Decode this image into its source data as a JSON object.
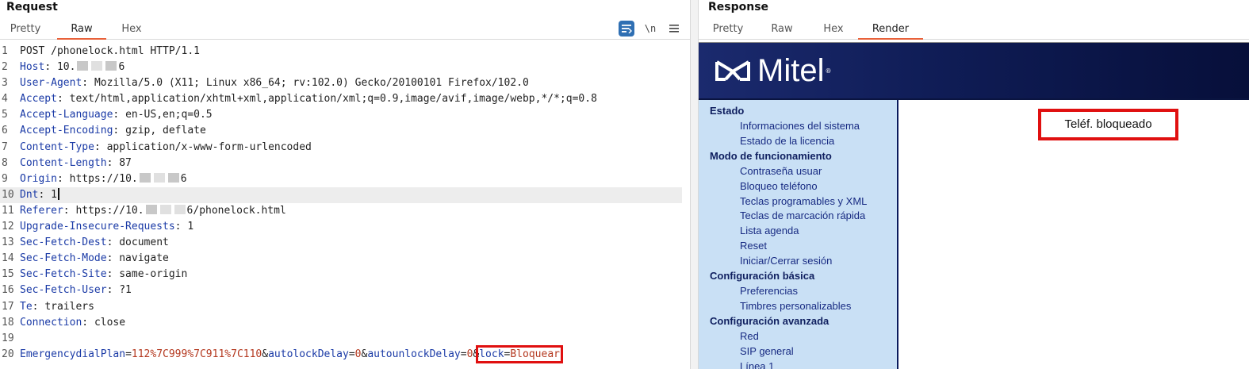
{
  "request": {
    "title": "Request",
    "tabs": [
      {
        "label": "Pretty"
      },
      {
        "label": "Raw"
      },
      {
        "label": "Hex"
      }
    ],
    "active_tab": "Raw",
    "tools": {
      "wrap_icon": "message-edit-icon",
      "newline_label": "\\n",
      "menu_icon": "hamburger-icon"
    },
    "lines": {
      "l1": "POST /phonelock.html HTTP/1.1",
      "l2_key": "Host",
      "l2_pre": "10.",
      "l2_post": "6",
      "l3_key": "User-Agent",
      "l3_val": "Mozilla/5.0 (X11; Linux x86_64; rv:102.0) Gecko/20100101 Firefox/102.0",
      "l4_key": "Accept",
      "l4_val": "text/html,application/xhtml+xml,application/xml;q=0.9,image/avif,image/webp,*/*;q=0.8",
      "l5_key": "Accept-Language",
      "l5_val": "en-US,en;q=0.5",
      "l6_key": "Accept-Encoding",
      "l6_val": "gzip, deflate",
      "l7_key": "Content-Type",
      "l7_val": "application/x-www-form-urlencoded",
      "l8_key": "Content-Length",
      "l8_val": "87",
      "l9_key": "Origin",
      "l9_pre": "https://10.",
      "l9_post": "6",
      "l10_key": "Dnt",
      "l10_val": "1",
      "l11_key": "Referer",
      "l11_pre": "https://10.",
      "l11_post": "6/phonelock.html",
      "l12_key": "Upgrade-Insecure-Requests",
      "l12_val": "1",
      "l13_key": "Sec-Fetch-Dest",
      "l13_val": "document",
      "l14_key": "Sec-Fetch-Mode",
      "l14_val": "navigate",
      "l15_key": "Sec-Fetch-Site",
      "l15_val": "same-origin",
      "l16_key": "Sec-Fetch-User",
      "l16_val": "?1",
      "l17_key": "Te",
      "l17_val": "trailers",
      "l18_key": "Connection",
      "l18_val": "close",
      "body": {
        "p1_key": "EmergencydialPlan",
        "p1_val": "112%7C999%7C911%7C110",
        "p2_key": "autolockDelay",
        "p2_val": "0",
        "p3_key": "autounlockDelay",
        "p3_val": "0",
        "p4_key": "lock",
        "p4_val": "Bloquear"
      }
    }
  },
  "response": {
    "title": "Response",
    "tabs": [
      {
        "label": "Pretty"
      },
      {
        "label": "Raw"
      },
      {
        "label": "Hex"
      },
      {
        "label": "Render"
      }
    ],
    "active_tab": "Render",
    "render": {
      "brand": "Mitel",
      "brand_mark": "®",
      "status": "Teléf. bloqueado",
      "menu": [
        {
          "section": "Estado",
          "items": [
            "Informaciones del sistema",
            "Estado de la licencia"
          ]
        },
        {
          "section": "Modo de funcionamiento",
          "items": [
            "Contraseña usuar",
            "Bloqueo teléfono",
            "Teclas programables y XML",
            "Teclas de marcación rápida",
            "Lista agenda",
            "Reset",
            "Iniciar/Cerrar sesión"
          ]
        },
        {
          "section": "Configuración básica",
          "items": [
            "Preferencias",
            "Timbres personalizables"
          ]
        },
        {
          "section": "Configuración avanzada",
          "items": [
            "Red",
            "SIP general",
            "Línea 1"
          ]
        }
      ]
    }
  },
  "colors": {
    "accent": "#e8613a",
    "highlight": "#e01010",
    "header_key": "#1a3aa6",
    "param_value": "#b4381f",
    "mitel_navy": "#0f1c55",
    "menu_bg": "#c9e0f5"
  }
}
